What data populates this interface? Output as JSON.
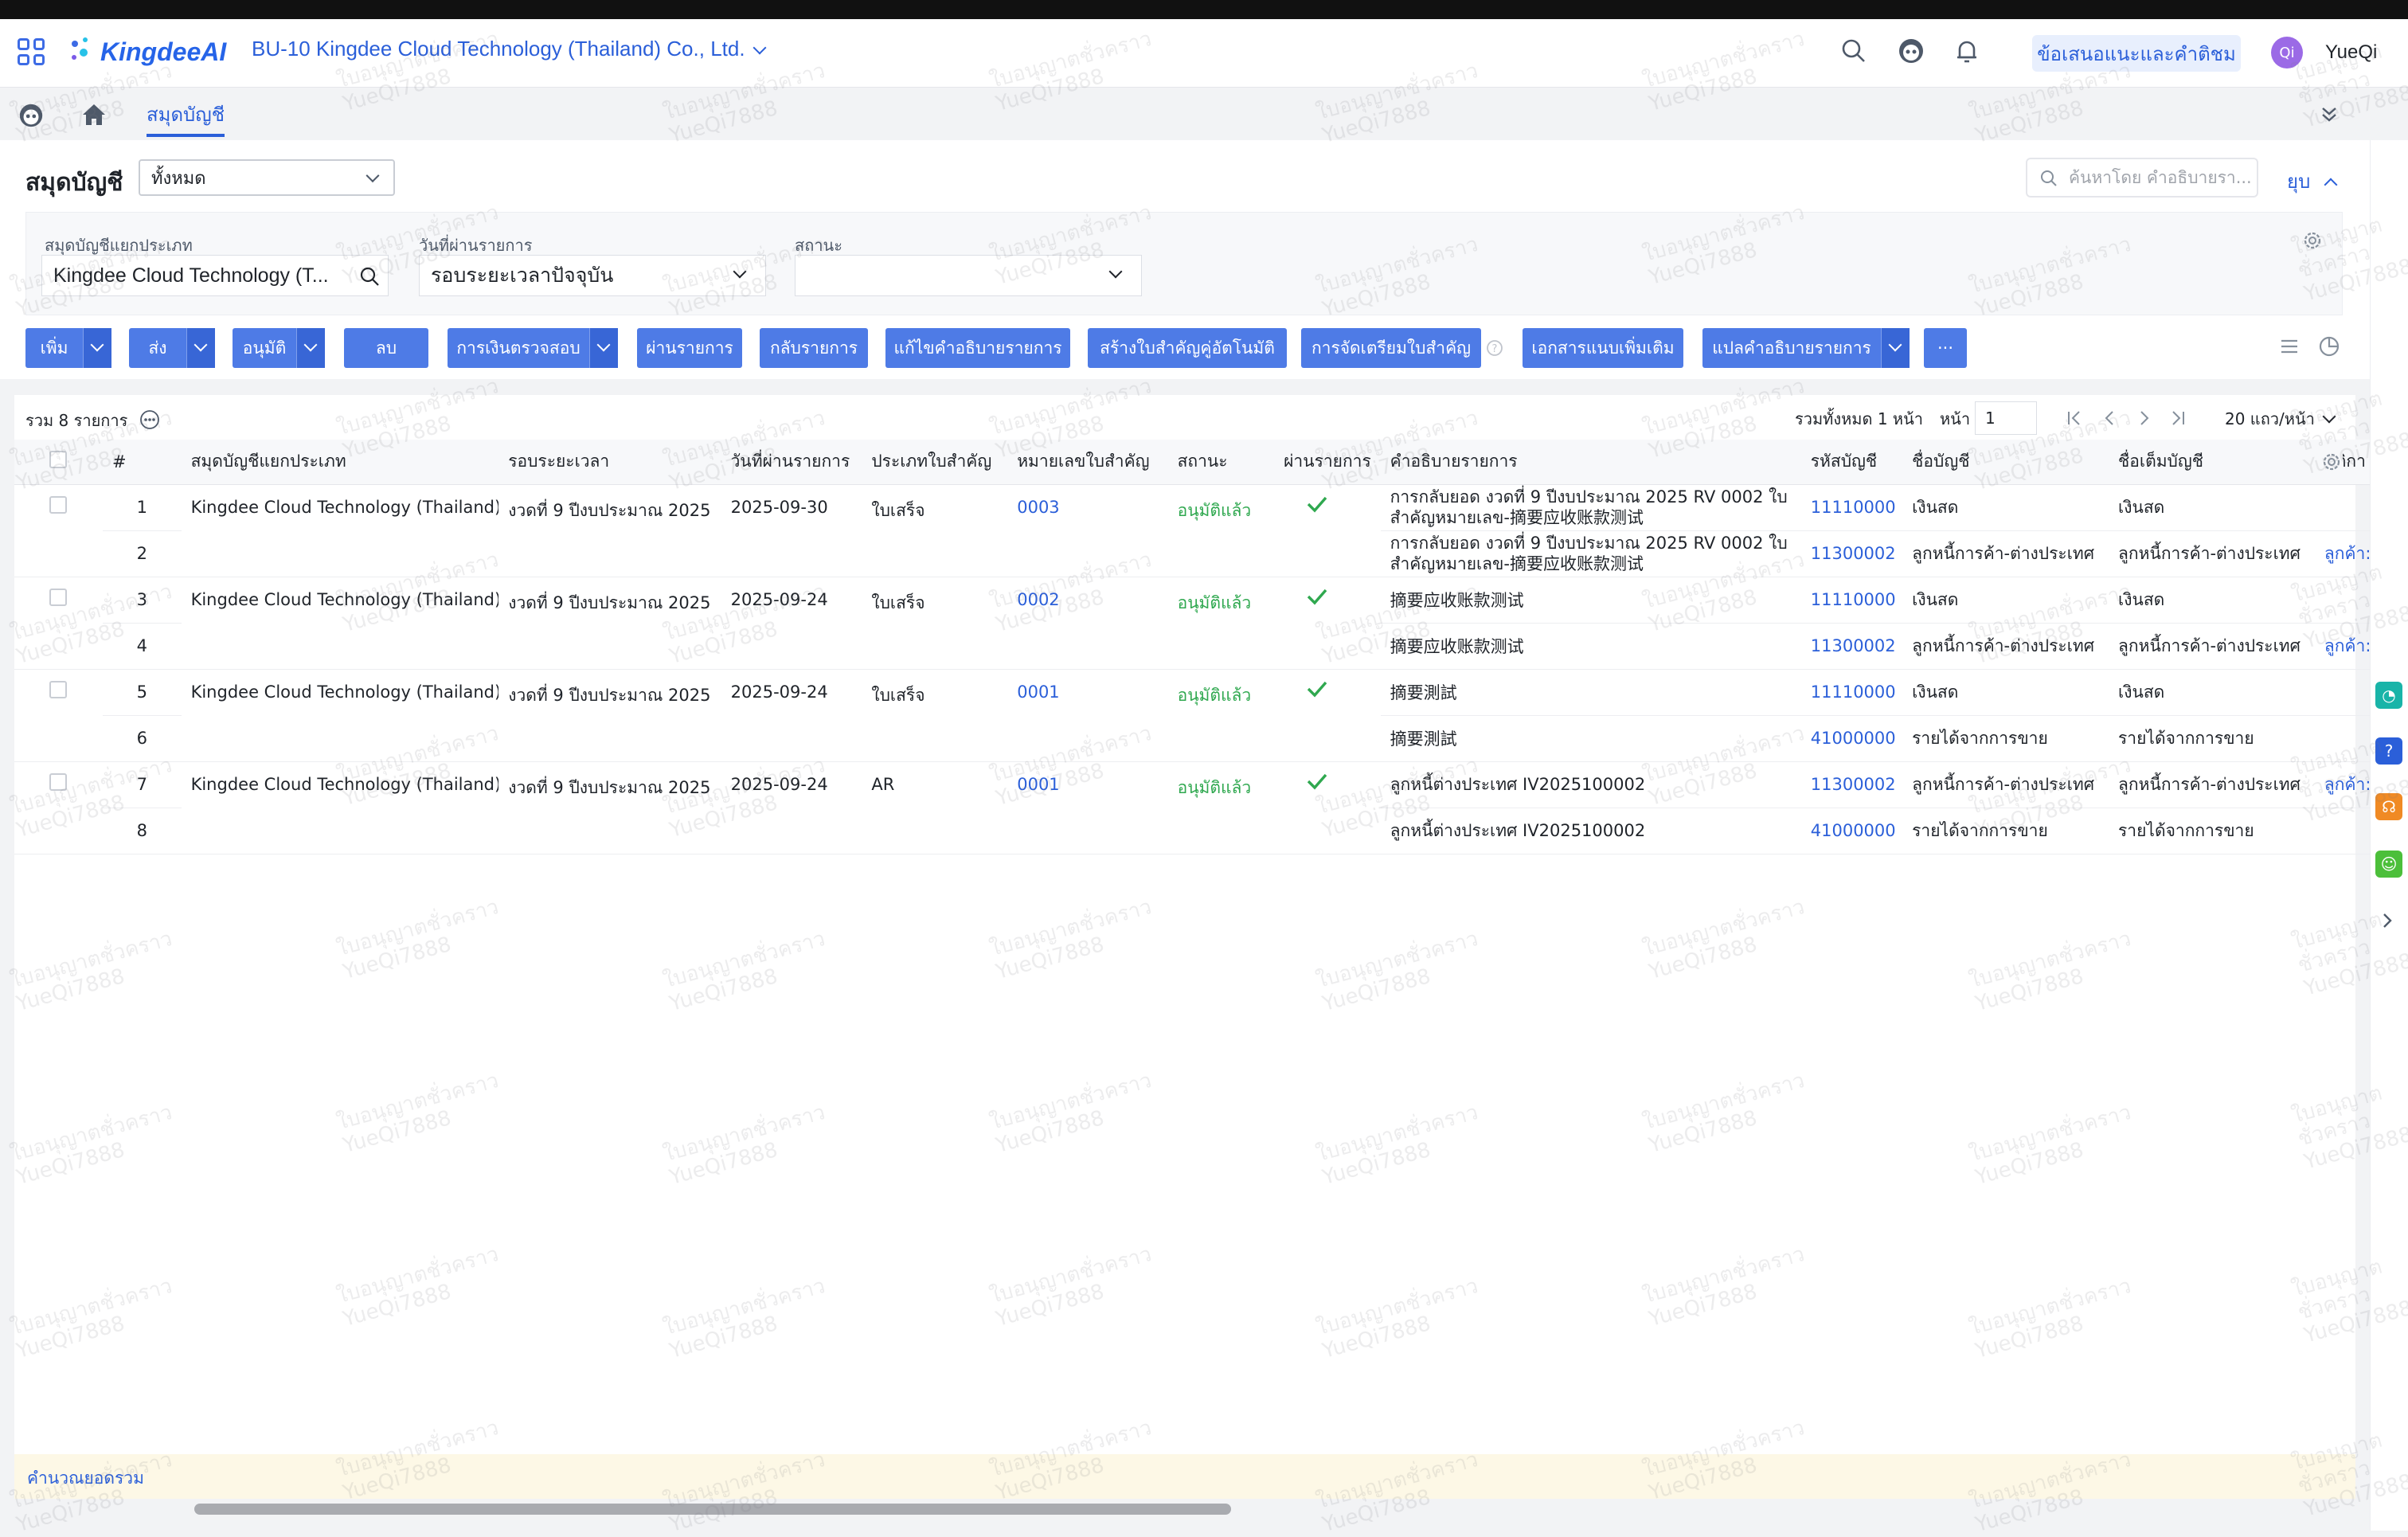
{
  "header": {
    "logo_text": "KingdeeAI",
    "company": "BU-10 Kingdee Cloud Technology (Thailand) Co., Ltd.",
    "suggest_label": "ข้อเสนอแนะและคำติชม",
    "avatar_initials": "Qi",
    "username": "YueQi"
  },
  "tabs": {
    "active_label": "สมุดบัญชี"
  },
  "page": {
    "title": "สมุดบัญชี",
    "scope_select": "ทั้งหมด",
    "search_placeholder": "ค้นหาโดย คำอธิบายรา...",
    "collapse_label": "ยุบ"
  },
  "filters": {
    "ledger_label": "สมุดบัญชีแยกประเภท",
    "ledger_value": "Kingdee Cloud Technology (T...",
    "date_label": "วันที่ผ่านรายการ",
    "date_value": "รอบระยะเวลาปัจจุบัน",
    "status_label": "สถานะ",
    "status_value": ""
  },
  "toolbar": {
    "add": "เพิ่ม",
    "submit": "ส่ง",
    "approve": "อนุมัติ",
    "delete": "ลบ",
    "cash_check": "การเงินตรวจสอบ",
    "post": "ผ่านรายการ",
    "unpost": "กลับรายการ",
    "edit_desc": "แก้ไขคำอธิบายรายการ",
    "auto_voucher": "สร้างใบสำคัญคู่อัตโนมัติ",
    "arrange_voucher": "การจัดเตรียมใบสำคัญ",
    "attachments": "เอกสารแนบเพิ่มเติม",
    "translate_desc": "แปลคำอธิบายรายการ",
    "more": "···"
  },
  "summary": {
    "total_label": "รวม 8 รายการ",
    "pages_label": "รวมทั้งหมด 1 หน้า",
    "page_label": "หน้า",
    "page_value": "1",
    "rows_per_page": "20 แถว/หน้า"
  },
  "table": {
    "headers": [
      "#",
      "สมุดบัญชีแยกประเภท",
      "รอบระยะเวลา",
      "วันที่ผ่านรายการ",
      "ประเภทใบสำคัญ",
      "หมายเลขใบสำคัญ",
      "สถานะ",
      "ผ่านรายการ",
      "คำอธิบายรายการ",
      "รหัสบัญชี",
      "ชื่อบัญชี",
      "ชื่อเต็มบัญชี",
      "มิติกา"
    ],
    "vouchers": [
      {
        "ledger": "Kingdee Cloud Technology (Thailand)",
        "period": "งวดที่ 9 ปีงบประมาณ 2025",
        "date": "2025-09-30",
        "type": "ใบเสร็จ",
        "number": "0003",
        "status": "อนุมัติแล้ว"
      },
      {
        "ledger": "Kingdee Cloud Technology (Thailand)",
        "period": "งวดที่ 9 ปีงบประมาณ 2025",
        "date": "2025-09-24",
        "type": "ใบเสร็จ",
        "number": "0002",
        "status": "อนุมัติแล้ว"
      },
      {
        "ledger": "Kingdee Cloud Technology (Thailand)",
        "period": "งวดที่ 9 ปีงบประมาณ 2025",
        "date": "2025-09-24",
        "type": "ใบเสร็จ",
        "number": "0001",
        "status": "อนุมัติแล้ว"
      },
      {
        "ledger": "Kingdee Cloud Technology (Thailand)",
        "period": "งวดที่ 9 ปีงบประมาณ 2025",
        "date": "2025-09-24",
        "type": "AR",
        "number": "0001",
        "status": "อนุมัติแล้ว"
      }
    ],
    "lines": [
      {
        "no": "1",
        "desc": "การกลับยอด งวดที่ 9 ปีงบประมาณ 2025 RV 0002 ใบสำคัญหมายเลข-摘要应收账款测试",
        "code": "11110000",
        "name": "เงินสด",
        "full": "เงินสด",
        "dim": ""
      },
      {
        "no": "2",
        "desc": "การกลับยอด งวดที่ 9 ปีงบประมาณ 2025 RV 0002 ใบสำคัญหมายเลข-摘要应收账款测试",
        "code": "11300002",
        "name": "ลูกหนี้การค้า-ต่างประเทศ",
        "full": "ลูกหนี้การค้า-ต่างประเทศ",
        "dim": "ลูกค้า:บริษั"
      },
      {
        "no": "3",
        "desc": "摘要应收账款测试",
        "code": "11110000",
        "name": "เงินสด",
        "full": "เงินสด",
        "dim": ""
      },
      {
        "no": "4",
        "desc": "摘要应收账款测试",
        "code": "11300002",
        "name": "ลูกหนี้การค้า-ต่างประเทศ",
        "full": "ลูกหนี้การค้า-ต่างประเทศ",
        "dim": "ลูกค้า:บริษั"
      },
      {
        "no": "5",
        "desc": "摘要測試",
        "code": "11110000",
        "name": "เงินสด",
        "full": "เงินสด",
        "dim": ""
      },
      {
        "no": "6",
        "desc": "摘要測試",
        "code": "41000000",
        "name": "รายได้จากการขาย",
        "full": "รายได้จากการขาย",
        "dim": ""
      },
      {
        "no": "7",
        "desc": "ลูกหนี้ต่างประเทศ IV2025100002",
        "code": "11300002",
        "name": "ลูกหนี้การค้า-ต่างประเทศ",
        "full": "ลูกหนี้การค้า-ต่างประเทศ",
        "dim": "ลูกค้า:บริษั"
      },
      {
        "no": "8",
        "desc": "ลูกหนี้ต่างประเทศ IV2025100002",
        "code": "41000000",
        "name": "รายได้จากการขาย",
        "full": "รายได้จากการขาย",
        "dim": ""
      }
    ]
  },
  "footer": {
    "calc_total": "คำนวณยอดรวม"
  },
  "watermark": {
    "line1": "ใบอนุญาตชั่วคราว",
    "line2": "YueQi7888"
  },
  "colors": {
    "primary": "#4e7be6",
    "link": "#2b5fd9",
    "approved": "#2fa84f"
  }
}
